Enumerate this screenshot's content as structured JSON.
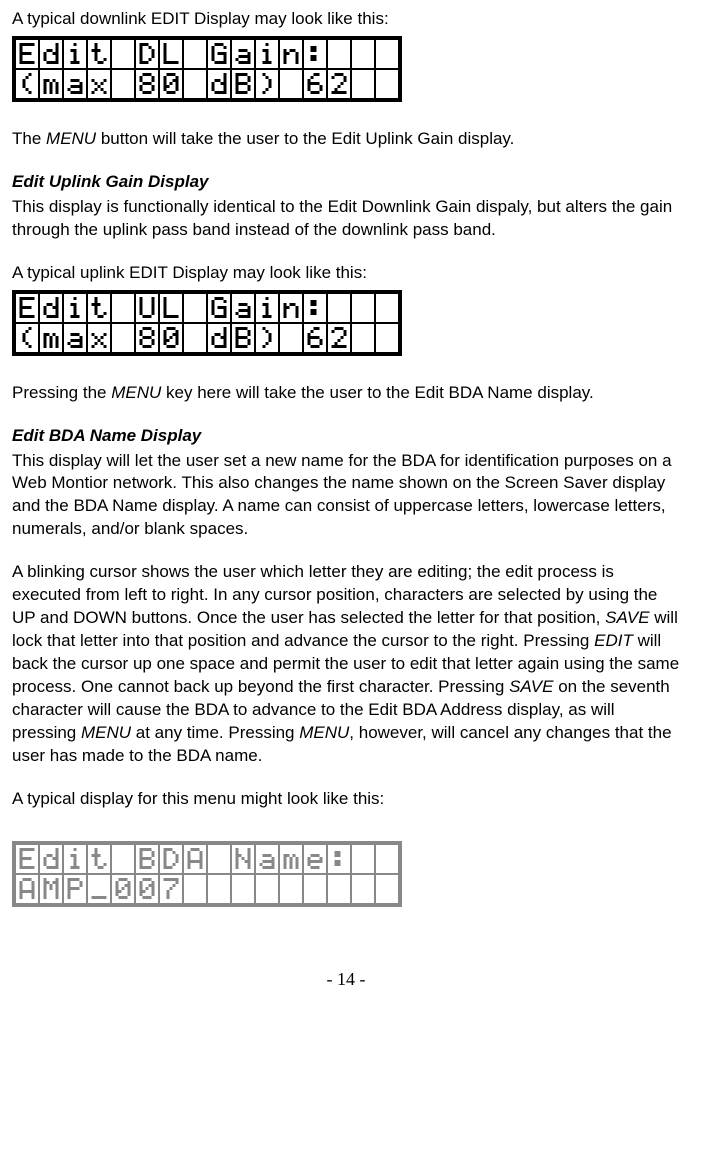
{
  "p1": "A typical downlink EDIT Display may look like this:",
  "lcd1": {
    "cols": 16,
    "row1": [
      "E",
      "d",
      "i",
      "t",
      " ",
      "D",
      "L",
      " ",
      "G",
      "a",
      "i",
      "n",
      ":",
      " ",
      " ",
      " "
    ],
    "row2": [
      "(",
      "m",
      "a",
      "x",
      " ",
      "8",
      "0",
      " ",
      "d",
      "B",
      ")",
      " ",
      "6",
      "2",
      " ",
      " "
    ]
  },
  "p2a": "The ",
  "p2b": "MENU",
  "p2c": " button will take the user to the Edit Uplink Gain display.",
  "h1": "Edit Uplink Gain Display",
  "p3": "This display is functionally identical to the Edit Downlink Gain dispaly, but alters the gain through the uplink pass band instead of the downlink pass band.",
  "p4": "A typical uplink EDIT Display may look like this:",
  "lcd2": {
    "cols": 16,
    "row1": [
      "E",
      "d",
      "i",
      "t",
      " ",
      "U",
      "L",
      " ",
      "G",
      "a",
      "i",
      "n",
      ":",
      " ",
      " ",
      " "
    ],
    "row2": [
      "(",
      "m",
      "a",
      "x",
      " ",
      "8",
      "0",
      " ",
      "d",
      "B",
      ")",
      " ",
      "6",
      "2",
      " ",
      " "
    ]
  },
  "p5a": "Pressing the ",
  "p5b": "MENU",
  "p5c": " key here will take the user to the Edit BDA Name display.",
  "h2": "Edit BDA Name Display",
  "p6": "This display will let the user set a new name for the BDA for identification purposes on a Web Montior network.  This also changes the name shown on the Screen Saver display and the BDA Name display.  A name can consist of uppercase letters, lowercase letters, numerals, and/or blank spaces.",
  "p7a": "A blinking cursor shows the user which letter they are editing; the edit process is executed from left to right.  In any cursor position, characters are selected by using the UP and DOWN buttons.  Once the user has selected the letter for that position, ",
  "p7b": "SAVE",
  "p7c": " will lock that letter into that position and advance the cursor to the right.  Pressing ",
  "p7d": "EDIT",
  "p7e": " will back the cursor up one space and permit the user to edit that letter again using the same process.  One cannot back up beyond the first character.  Pressing ",
  "p7f": "SAVE",
  "p7g": " on the seventh character will cause the BDA to advance to the Edit BDA Address display, as will pressing ",
  "p7h": "MENU",
  "p7i": " at any time.  Pressing ",
  "p7j": "MENU",
  "p7k": ", however, will cancel any changes that the user has made to the BDA name.",
  "p8": "A typical display for this menu might look like this:",
  "lcd3": {
    "cols": 16,
    "row1": [
      "E",
      "d",
      "i",
      "t",
      " ",
      "B",
      "D",
      "A",
      " ",
      "N",
      "a",
      "m",
      "e",
      ":",
      " ",
      " "
    ],
    "row2": [
      "A",
      "M",
      "P",
      "_",
      "0",
      "0",
      "7",
      " ",
      " ",
      " ",
      " ",
      " ",
      " ",
      " ",
      " ",
      " "
    ]
  },
  "pageno": "- 14 -"
}
